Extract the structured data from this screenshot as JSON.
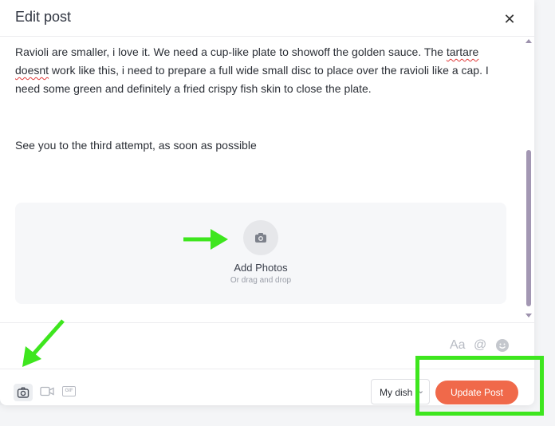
{
  "modal": {
    "title": "Edit post",
    "close_icon": "close-icon"
  },
  "post": {
    "paragraph1_parts": [
      "Ravioli are smaller, i love it. We need a cup-like plate to showoff the golden sauce. The ",
      "tartare",
      " ",
      "doesnt",
      " work like this, i need to prepare a full wide small disc to place over the ravioli like a cap. I need some green and definitely a fried crispy fish skin to close the plate."
    ],
    "paragraph2": "See you to the third attempt, as soon as possible"
  },
  "dropzone": {
    "icon": "camera-icon",
    "label": "Add Photos",
    "sublabel": "Or drag and drop"
  },
  "editor_tools": {
    "text_format_label": "Aa",
    "mention_icon": "at-icon",
    "emoji_icon": "smile-icon"
  },
  "footer": {
    "photo_icon": "camera-icon",
    "video_icon": "video-icon",
    "gif_label": "GIF",
    "dish_select_value": "My dish",
    "update_button_label": "Update Post"
  },
  "annotations": {
    "highlight_color": "#3ee61e",
    "accent_color": "#f0694a"
  }
}
